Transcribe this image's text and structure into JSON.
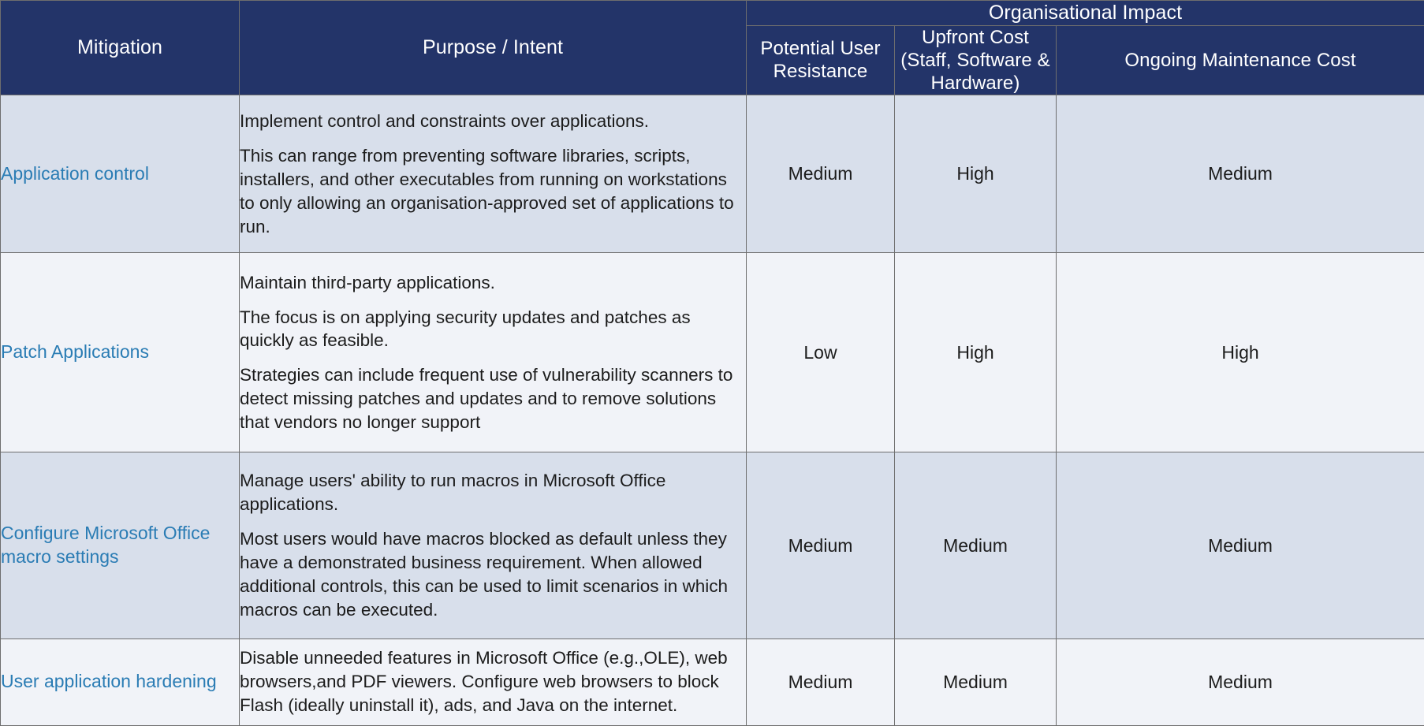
{
  "palette": {
    "header_bg": "#233469",
    "header_text": "#ffffff",
    "row_band_dark": "#d8dfeb",
    "row_band_light": "#f1f3f8",
    "mitigation_link": "#2a7cb4",
    "body_text": "#1c1c1c",
    "border": "#6e6e6e"
  },
  "header": {
    "mitigation": "Mitigation",
    "purpose": "Purpose / Intent",
    "group_impact": "Organisational Impact",
    "sub_user_resistance": "Potential User Resistance",
    "sub_upfront_cost": "Upfront Cost (Staff, Software & Hardware)",
    "sub_ongoing_cost": "Ongoing Maintenance Cost"
  },
  "rows": [
    {
      "mitigation": "Application control",
      "purpose_paragraphs": [
        "Implement control and constraints over applications.",
        "This can range from preventing software libraries, scripts, installers, and other executables from running on workstations to only allowing an organisation-approved set of applications to run."
      ],
      "user_resistance": "Medium",
      "upfront_cost": "High",
      "ongoing_cost": "Medium"
    },
    {
      "mitigation": "Patch Applications",
      "purpose_paragraphs": [
        "Maintain third-party applications.",
        "The focus is on applying security updates and patches as quickly as feasible.",
        "Strategies can include frequent use of vulnerability scanners to detect missing patches and updates and to remove solutions that vendors no longer support"
      ],
      "user_resistance": "Low",
      "upfront_cost": "High",
      "ongoing_cost": "High"
    },
    {
      "mitigation": "Configure Microsoft Office macro settings",
      "purpose_paragraphs": [
        "Manage users' ability to run macros in Microsoft Office applications.",
        "Most users would have macros blocked as default unless they have a demonstrated business requirement. When allowed additional controls, this can be used to limit scenarios in which macros can be executed."
      ],
      "user_resistance": "Medium",
      "upfront_cost": "Medium",
      "ongoing_cost": "Medium"
    },
    {
      "mitigation": "User application hardening",
      "purpose_paragraphs": [
        "Disable unneeded features in Microsoft Office (e.g.,OLE), web browsers,and PDF viewers. Configure web browsers to block Flash (ideally uninstall it), ads, and Java on the internet."
      ],
      "user_resistance": "Medium",
      "upfront_cost": "Medium",
      "ongoing_cost": "Medium"
    }
  ]
}
